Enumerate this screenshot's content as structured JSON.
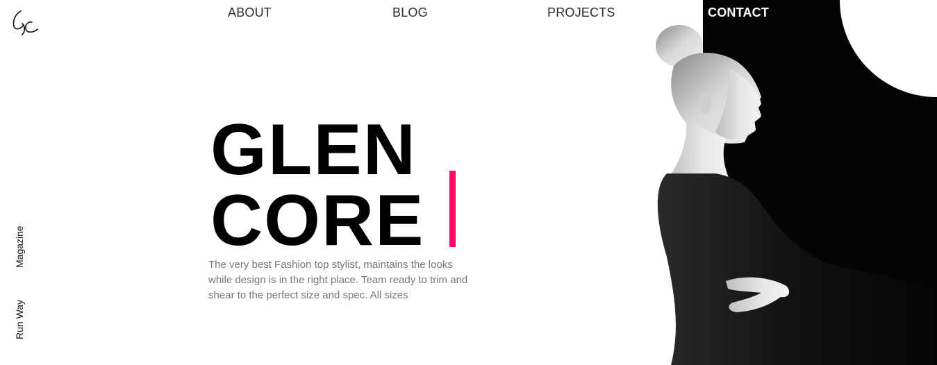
{
  "brand": {
    "logo_text": "GC"
  },
  "nav": {
    "items": [
      {
        "label": "ABOUT"
      },
      {
        "label": "BLOG"
      },
      {
        "label": "PROJECTS"
      },
      {
        "label": "CONTACT"
      }
    ]
  },
  "side": {
    "magazine": "Magazine",
    "runway": "Run Way"
  },
  "hero": {
    "title_line1": "GLEN",
    "title_line2": "CORE",
    "tagline": "The very best Fashion top stylist, maintains the looks while design is in the right place. Team ready to trim and shear to the perfect size and spec. All sizes"
  },
  "colors": {
    "accent": "#ff0a6c",
    "dark": "#000000",
    "text_muted": "#777777"
  }
}
